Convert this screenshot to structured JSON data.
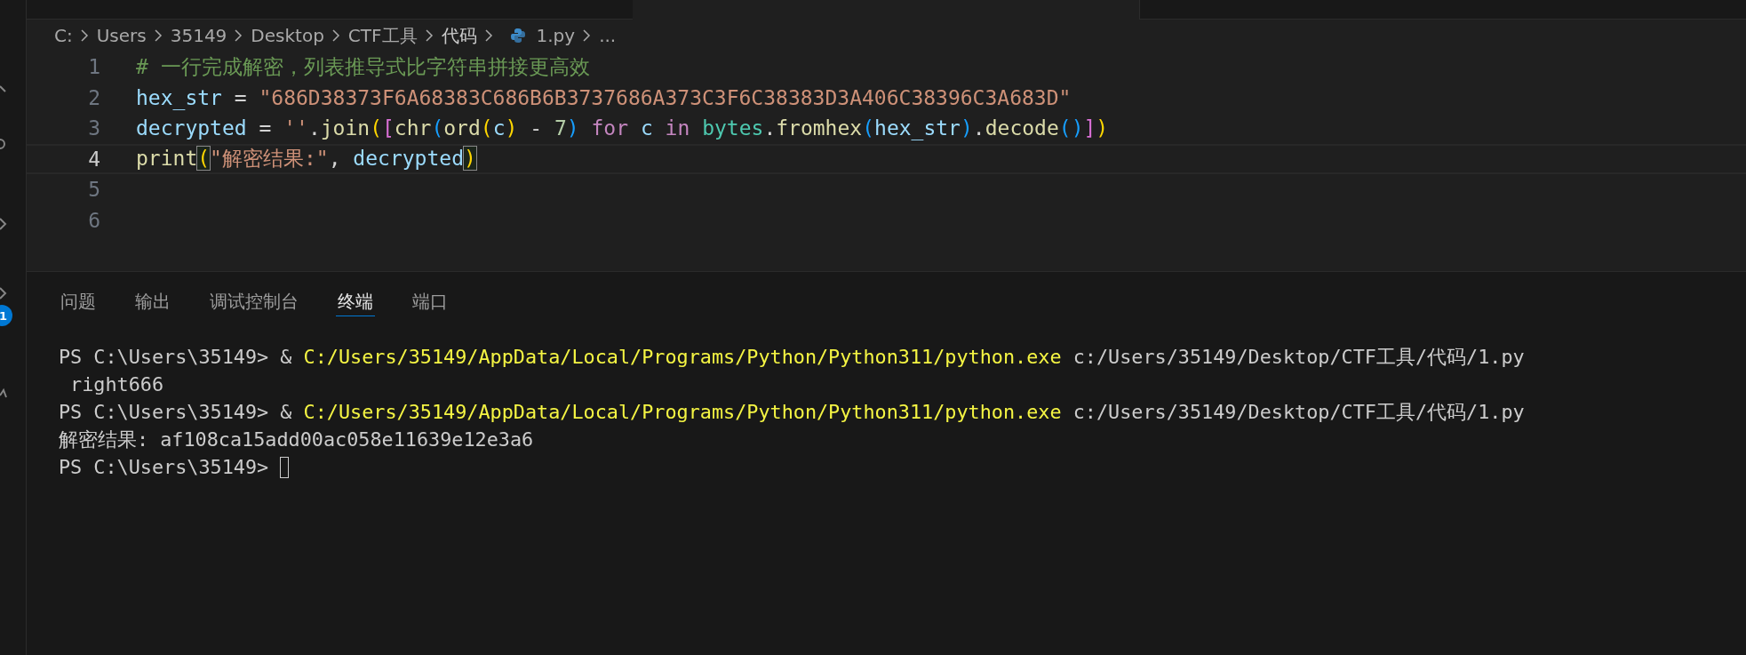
{
  "activity_bar": {
    "badge": "1"
  },
  "breadcrumb": [
    {
      "kind": "folder",
      "label": "C:"
    },
    {
      "kind": "folder",
      "label": "Users"
    },
    {
      "kind": "folder",
      "label": "35149"
    },
    {
      "kind": "folder",
      "label": "Desktop"
    },
    {
      "kind": "folder",
      "label": "CTF工具"
    },
    {
      "kind": "folder",
      "label": "代码"
    },
    {
      "kind": "python-file",
      "label": "1.py"
    },
    {
      "kind": "more",
      "label": "..."
    }
  ],
  "editor": {
    "lines": [
      {
        "number": "1",
        "current": false,
        "tokens": [
          {
            "kind": "comment",
            "text": "# 一行完成解密，列表推导式比字符串拼接更高效"
          }
        ]
      },
      {
        "number": "2",
        "current": false,
        "tokens": [
          {
            "kind": "variable",
            "text": "hex_str"
          },
          {
            "kind": "plain",
            "text": " = "
          },
          {
            "kind": "string",
            "text": "\"686D38373F6A68383C686B6B3737686A373C3F6C38383D3A406C38396C3A683D\""
          }
        ]
      },
      {
        "number": "3",
        "current": false,
        "tokens": [
          {
            "kind": "variable",
            "text": "decrypted"
          },
          {
            "kind": "plain",
            "text": " = "
          },
          {
            "kind": "string",
            "text": "''"
          },
          {
            "kind": "plain",
            "text": "."
          },
          {
            "kind": "function",
            "text": "join"
          },
          {
            "kind": "bracket1",
            "text": "("
          },
          {
            "kind": "bracket2",
            "text": "["
          },
          {
            "kind": "function",
            "text": "chr"
          },
          {
            "kind": "bracket3",
            "text": "("
          },
          {
            "kind": "function",
            "text": "ord"
          },
          {
            "kind": "bracket1",
            "text": "("
          },
          {
            "kind": "variable",
            "text": "c"
          },
          {
            "kind": "bracket1",
            "text": ")"
          },
          {
            "kind": "plain",
            "text": " - "
          },
          {
            "kind": "number",
            "text": "7"
          },
          {
            "kind": "bracket3",
            "text": ")"
          },
          {
            "kind": "keyword",
            "text": " for"
          },
          {
            "kind": "variable",
            "text": " c"
          },
          {
            "kind": "keyword",
            "text": " in"
          },
          {
            "kind": "class",
            "text": " bytes"
          },
          {
            "kind": "plain",
            "text": "."
          },
          {
            "kind": "function",
            "text": "fromhex"
          },
          {
            "kind": "bracket3",
            "text": "("
          },
          {
            "kind": "variable",
            "text": "hex_str"
          },
          {
            "kind": "bracket3",
            "text": ")"
          },
          {
            "kind": "plain",
            "text": "."
          },
          {
            "kind": "function",
            "text": "decode"
          },
          {
            "kind": "bracket3",
            "text": "("
          },
          {
            "kind": "bracket3",
            "text": ")"
          },
          {
            "kind": "bracket2",
            "text": "]"
          },
          {
            "kind": "bracket1",
            "text": ")"
          }
        ]
      },
      {
        "number": "4",
        "current": true,
        "tokens": [
          {
            "kind": "function",
            "text": "print"
          },
          {
            "kind": "bracket1-match",
            "text": "("
          },
          {
            "kind": "string",
            "text": "\"解密结果:\""
          },
          {
            "kind": "plain",
            "text": ", "
          },
          {
            "kind": "variable",
            "text": "decrypted"
          },
          {
            "kind": "bracket1-match",
            "text": ")"
          }
        ]
      },
      {
        "number": "5",
        "current": false
      },
      {
        "number": "6",
        "current": false
      }
    ]
  },
  "panel": {
    "tabs": [
      {
        "label": "问题",
        "selected": false
      },
      {
        "label": "输出",
        "selected": false
      },
      {
        "label": "调试控制台",
        "selected": false
      },
      {
        "label": "终端",
        "selected": true
      },
      {
        "label": "端口",
        "selected": false
      }
    ],
    "terminal": [
      [
        {
          "kind": "prompt",
          "text": "PS C:\\Users\\35149> & "
        },
        {
          "kind": "command",
          "text": "C:/Users/35149/AppData/Local/Programs/Python/Python311/python.exe"
        },
        {
          "kind": "prompt",
          "text": " c:/Users/35149/Desktop/CTF工具/代码/1.py"
        }
      ],
      [
        {
          "kind": "prompt",
          "text": " right666"
        }
      ],
      [
        {
          "kind": "prompt",
          "text": "PS C:\\Users\\35149> & "
        },
        {
          "kind": "command",
          "text": "C:/Users/35149/AppData/Local/Programs/Python/Python311/python.exe"
        },
        {
          "kind": "prompt",
          "text": " c:/Users/35149/Desktop/CTF工具/代码/1.py"
        }
      ],
      [
        {
          "kind": "prompt",
          "text": "解密结果: af108ca15add00ac058e11639e12e3a6"
        }
      ],
      [
        {
          "kind": "prompt",
          "text": "PS C:\\Users\\35149> "
        },
        {
          "kind": "cursor"
        }
      ]
    ]
  }
}
